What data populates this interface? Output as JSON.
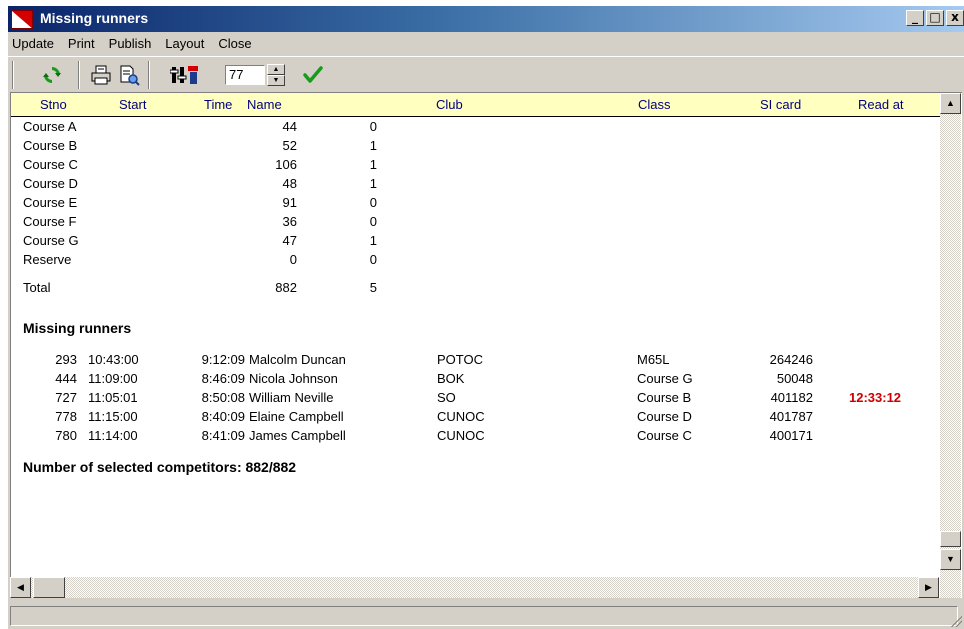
{
  "window": {
    "title": "Missing runners",
    "controls": {
      "minimize": "_",
      "maximize": "□",
      "close": "x"
    }
  },
  "menu": [
    "Update",
    "Print",
    "Publish",
    "Layout",
    "Close"
  ],
  "toolbar": {
    "spin_value": "77"
  },
  "columns": [
    "Stno",
    "Start",
    "Time",
    "Name",
    "Club",
    "Class",
    "SI card",
    "Read at"
  ],
  "courses": [
    {
      "name": "Course A",
      "count": "44",
      "missing": "0"
    },
    {
      "name": "Course B",
      "count": "52",
      "missing": "1"
    },
    {
      "name": "Course C",
      "count": "106",
      "missing": "1"
    },
    {
      "name": "Course D",
      "count": "48",
      "missing": "1"
    },
    {
      "name": "Course E",
      "count": "91",
      "missing": "0"
    },
    {
      "name": "Course F",
      "count": "36",
      "missing": "0"
    },
    {
      "name": "Course G",
      "count": "47",
      "missing": "1"
    },
    {
      "name": "Reserve",
      "count": "0",
      "missing": "0"
    }
  ],
  "total": {
    "label": "Total",
    "count": "882",
    "missing": "5"
  },
  "section_title": "Missing runners",
  "runners": [
    {
      "stno": "293",
      "start": "10:43:00",
      "time": "9:12:09",
      "name": "Malcolm Duncan",
      "club": "POTOC",
      "class": "M65L",
      "si_card": "264246",
      "read_at": ""
    },
    {
      "stno": "444",
      "start": "11:09:00",
      "time": "8:46:09",
      "name": "Nicola Johnson",
      "club": "BOK",
      "class": "Course G",
      "si_card": "50048",
      "read_at": ""
    },
    {
      "stno": "727",
      "start": "11:05:01",
      "time": "8:50:08",
      "name": "William Neville",
      "club": "SO",
      "class": "Course B",
      "si_card": "401182",
      "read_at": "12:33:12"
    },
    {
      "stno": "778",
      "start": "11:15:00",
      "time": "8:40:09",
      "name": "Elaine Campbell",
      "club": "CUNOC",
      "class": "Course D",
      "si_card": "401787",
      "read_at": ""
    },
    {
      "stno": "780",
      "start": "11:14:00",
      "time": "8:41:09",
      "name": "James Campbell",
      "club": "CUNOC",
      "class": "Course C",
      "si_card": "400171",
      "read_at": ""
    }
  ],
  "footer": "Number of selected competitors:  882/882",
  "colors": {
    "header_bg": "#ffffc0",
    "header_text": "#000080",
    "read_at_red": "#cc0000",
    "title_blue": "#0a246a"
  },
  "icons": [
    "app-logo-icon",
    "refresh-icon",
    "print-icon",
    "print-preview-icon",
    "filter-settings-icon",
    "apply-check-icon"
  ]
}
